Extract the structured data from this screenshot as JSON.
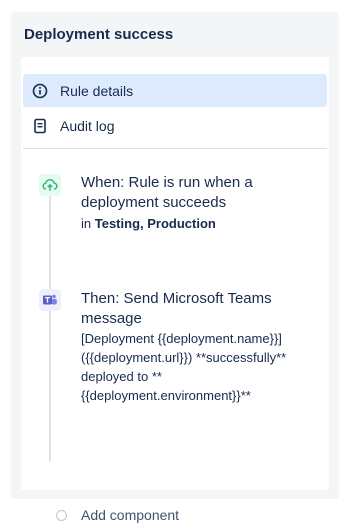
{
  "panel": {
    "title": "Deployment success"
  },
  "nav": {
    "items": [
      {
        "label": "Rule details",
        "icon": "info-icon",
        "active": true
      },
      {
        "label": "Audit log",
        "icon": "document-icon",
        "active": false
      }
    ]
  },
  "trigger": {
    "icon": "cloud-upload-icon",
    "title": "When: Rule is run when a deployment succeeds",
    "prefix": "in",
    "environments": "Testing, Production"
  },
  "action": {
    "icon": "microsoft-teams-icon",
    "title": "Then: Send Microsoft Teams message",
    "message": "[Deployment {{deployment.name}}]({{deployment.url}}) **successfully** deployed to **{{deployment.environment}}**"
  },
  "add_component": {
    "label": "Add component"
  },
  "colors": {
    "active_bg": "#deebff",
    "trigger_green": "#36b37e",
    "teams_purple": "#5b5fc7",
    "text": "#172b4d"
  }
}
